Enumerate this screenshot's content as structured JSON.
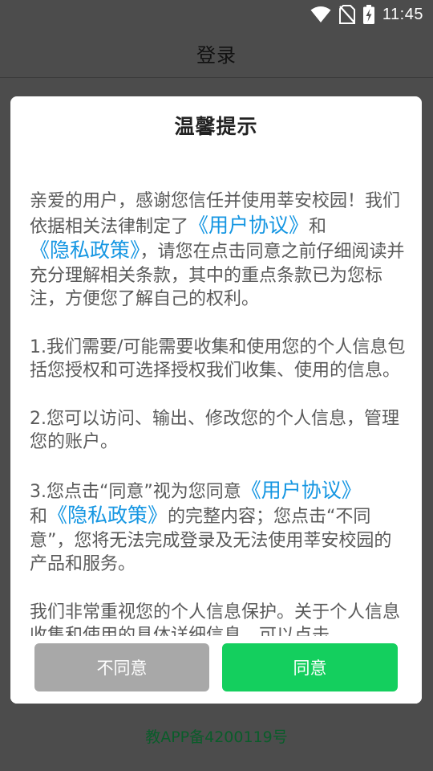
{
  "status_bar": {
    "time": "11:45",
    "icons": [
      "wifi-icon",
      "no-sim-icon",
      "battery-charging-icon"
    ]
  },
  "app_bar": {
    "title": "登录"
  },
  "dialog": {
    "title": "温馨提示",
    "paragraphs": {
      "p1_a": "亲爱的用户，感谢您信任并使用莘安校园！我们依据相关法律制定了",
      "link_user_agreement_1": "《用户协议》",
      "p1_b": "和",
      "link_privacy_policy_1": "《隐私政策》",
      "p1_c": "，请您在点击同意之前仔细阅读并充分理解相关条款，其中的重点条款已为您标注，方便您了解自己的权利。",
      "p2": "1.我们需要/可能需要收集和使用您的个人信息包括您授权和可选择授权我们收集、使用的信息。",
      "p3": "2.您可以访问、输出、修改您的个人信息，管理您的账户。",
      "p4_a": "3.您点击“同意”视为您同意",
      "link_user_agreement_2": "《用户协议》",
      "p4_b": "和",
      "link_privacy_policy_2": "《隐私政策》",
      "p4_c": "的完整内容；您点击“不同意”，您将无法完成登录及无法使用莘安校园的产品和服务。",
      "p5": "我们非常重视您的个人信息保护。关于个人信息收集和使用的具体详细信息，可以点击"
    },
    "buttons": {
      "disagree": "不同意",
      "agree": "同意"
    }
  },
  "footer": {
    "record": "教APP备4200119号"
  },
  "colors": {
    "link": "#1596e2",
    "agree_button": "#14cf5e",
    "disagree_button": "#a8a8a8",
    "record_text": "#0a5c2a"
  }
}
